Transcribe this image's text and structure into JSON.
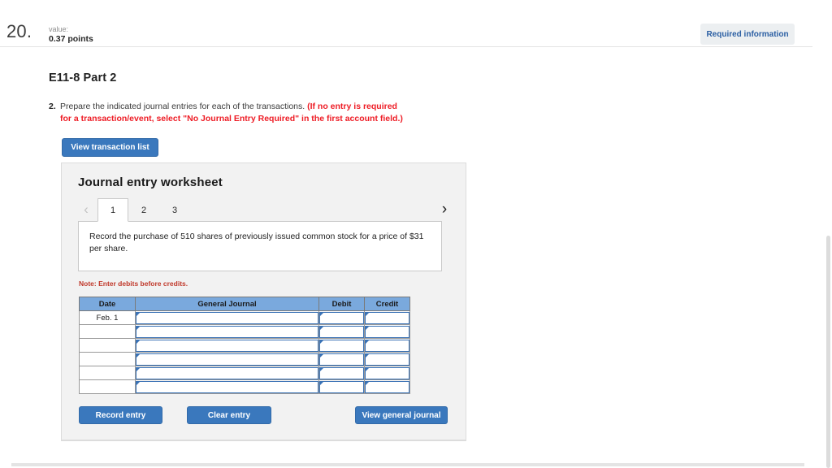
{
  "header": {
    "question_number": "20.",
    "value_label": "value:",
    "value_points": "0.37 points",
    "required_badge": "Required information"
  },
  "content": {
    "part_title": "E11-8 Part 2",
    "instruction_number": "2.",
    "instruction_text": "Prepare the indicated journal entries for each of the transactions. ",
    "instruction_red": "(If no entry is required for a transaction/event, select \"No Journal Entry Required\" in the first account field.)",
    "view_transaction_list_button": "View transaction list"
  },
  "worksheet": {
    "title": "Journal entry worksheet",
    "prev_chevron": "‹",
    "next_chevron": "›",
    "tabs": [
      {
        "label": "1",
        "active": true
      },
      {
        "label": "2",
        "active": false
      },
      {
        "label": "3",
        "active": false
      }
    ],
    "description": "Record the purchase of 510 shares of previously issued common stock for a price of $31 per share.",
    "note": "Note: Enter debits before credits.",
    "table": {
      "columns": [
        "Date",
        "General Journal",
        "Debit",
        "Credit"
      ],
      "rows": [
        {
          "date": "Feb. 1",
          "general_journal": "",
          "debit": "",
          "credit": ""
        },
        {
          "date": "",
          "general_journal": "",
          "debit": "",
          "credit": ""
        },
        {
          "date": "",
          "general_journal": "",
          "debit": "",
          "credit": ""
        },
        {
          "date": "",
          "general_journal": "",
          "debit": "",
          "credit": ""
        },
        {
          "date": "",
          "general_journal": "",
          "debit": "",
          "credit": ""
        },
        {
          "date": "",
          "general_journal": "",
          "debit": "",
          "credit": ""
        }
      ]
    },
    "buttons": {
      "record_entry": "Record entry",
      "clear_entry": "Clear entry",
      "view_general_journal": "View general journal"
    }
  },
  "colors": {
    "accent_blue": "#3a78bd",
    "table_header_blue": "#7aa9dd",
    "input_border_blue": "#3a72b5",
    "alert_red": "#ee1c25",
    "note_red": "#c0392b",
    "panel_gray": "#f2f2f2"
  }
}
